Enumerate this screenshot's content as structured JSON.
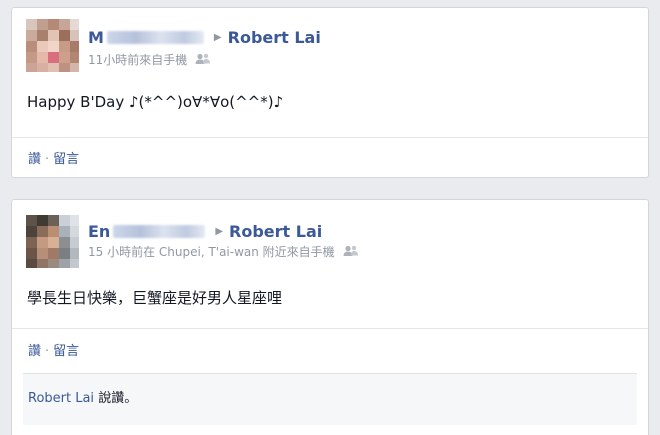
{
  "posts": [
    {
      "author_initial": "M",
      "target": "Robert Lai",
      "meta": "11小時前來自手機",
      "audience_icon": "friends-icon",
      "body": "Happy B'Day ♪(*^^)o∀*∀o(^^*)♪",
      "actions": {
        "like": "讚",
        "separator": "·",
        "comment": "留言"
      }
    },
    {
      "author_initial": "En",
      "target": "Robert Lai",
      "meta": "15 小時前在 Chupei, T'ai-wan 附近來自手機",
      "audience_icon": "friends-icon",
      "body": "學長生日快樂，巨蟹座是好男人星座哩",
      "actions": {
        "like": "讚",
        "separator": "·",
        "comment": "留言"
      },
      "likes": {
        "name": "Robert Lai",
        "suffix": " 說讚。"
      }
    }
  ],
  "colors": {
    "link": "#3b5998",
    "meta": "#9197a3",
    "background": "#e9ebee"
  }
}
